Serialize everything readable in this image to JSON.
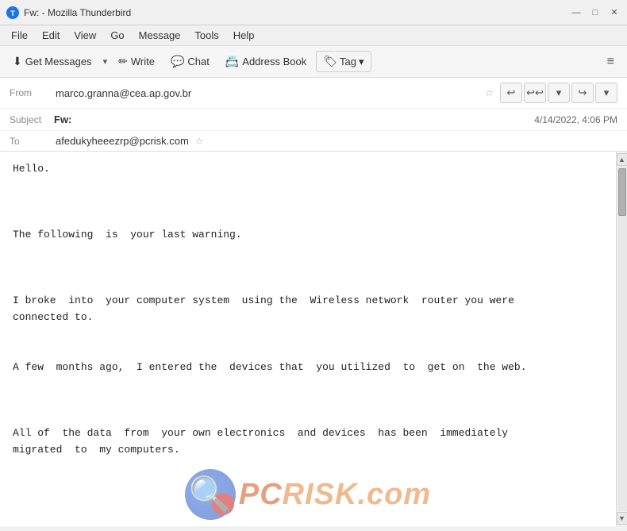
{
  "titlebar": {
    "icon": "🦅",
    "title": "Fw: - Mozilla Thunderbird",
    "minimize": "—",
    "maximize": "□",
    "close": "✕"
  },
  "menubar": {
    "items": [
      "File",
      "Edit",
      "View",
      "Go",
      "Message",
      "Tools",
      "Help"
    ]
  },
  "toolbar": {
    "get_messages_label": "Get Messages",
    "write_label": "Write",
    "chat_label": "Chat",
    "address_book_label": "Address Book",
    "tag_label": "Tag",
    "hamburger": "≡"
  },
  "email": {
    "from_label": "From",
    "from_value": "marco.granna@cea.ap.gov.br",
    "subject_label": "Subject",
    "subject_value": "Fw:",
    "date_value": "4/14/2022, 4:06 PM",
    "to_label": "To",
    "to_value": "afedukyheeezrp@pcrisk.com",
    "body": "Hello.\n\n\n\nThe following  is  your last warning.\n\n\n\nI broke  into  your computer system  using the  Wireless network  router you were\nconnected to.\n\n\nA few  months ago,  I entered the  devices that  you utilized  to  get on  the web.\n\n\n\nAll of  the data  from  your own electronics  and devices  has been  immediately\nmigrated  to  my computers."
  },
  "watermark": {
    "text": "RISK.com"
  }
}
